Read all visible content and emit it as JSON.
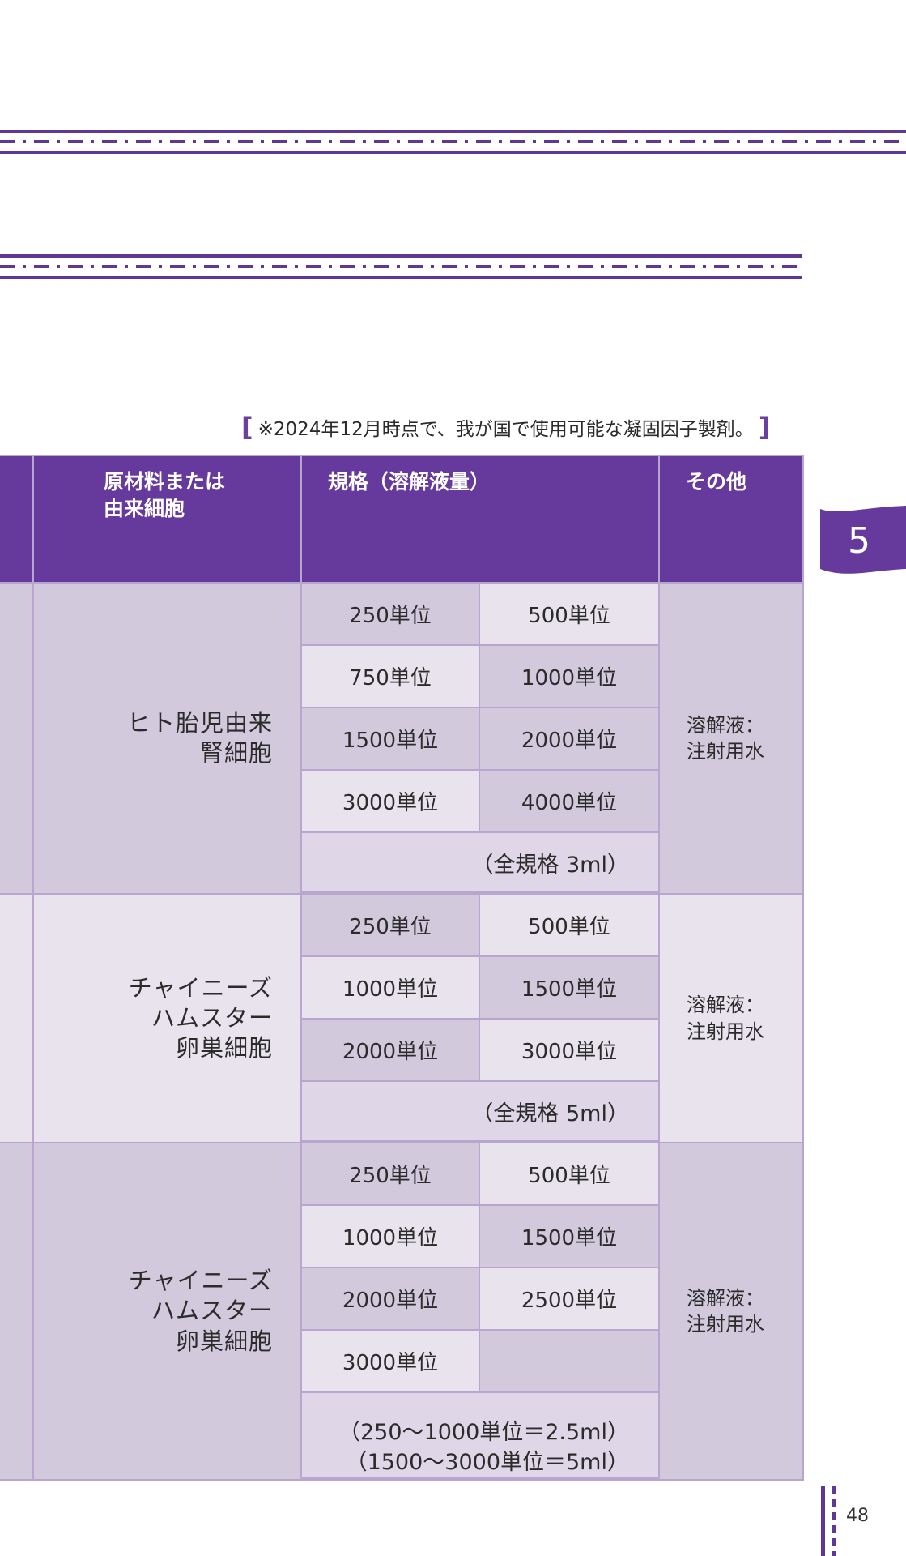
{
  "note": {
    "text": "※2024年12月時点で、我が国で使用可能な凝固因子製剤。",
    "bracket_left": "[",
    "bracket_right": "]"
  },
  "table": {
    "headers": {
      "source_line1": "原材料または",
      "source_line2": "由来細胞",
      "spec": "規格（溶解液量）",
      "other": "その他"
    },
    "rows": [
      {
        "source_lines": [
          "ヒト胎児由来",
          "腎細胞"
        ],
        "units": [
          [
            "250単位",
            "500単位"
          ],
          [
            "750単位",
            "1000単位"
          ],
          [
            "1500単位",
            "2000単位"
          ],
          [
            "3000単位",
            "4000単位"
          ]
        ],
        "note_lines": [
          "（全規格 3ml）"
        ],
        "other_lines": [
          "溶解液：",
          "注射用水"
        ]
      },
      {
        "source_lines": [
          "チャイニーズ",
          "ハムスター",
          "卵巣細胞"
        ],
        "units": [
          [
            "250単位",
            "500単位"
          ],
          [
            "1000単位",
            "1500単位"
          ],
          [
            "2000単位",
            "3000単位"
          ]
        ],
        "note_lines": [
          "（全規格 5ml）"
        ],
        "other_lines": [
          "溶解液：",
          "注射用水"
        ]
      },
      {
        "source_lines": [
          "チャイニーズ",
          "ハムスター",
          "卵巣細胞"
        ],
        "units": [
          [
            "250単位",
            "500単位"
          ],
          [
            "1000単位",
            "1500単位"
          ],
          [
            "2000単位",
            "2500単位"
          ],
          [
            "3000単位",
            ""
          ]
        ],
        "note_lines": [
          "（250～1000単位＝2.5ml）",
          "（1500～3000単位＝5ml）"
        ],
        "other_lines": [
          "溶解液：",
          "注射用水"
        ]
      }
    ]
  },
  "tab": {
    "label": "5"
  },
  "page": {
    "number": "48"
  },
  "colors": {
    "accent": "#653a9c",
    "pale": "#e8e3ec",
    "mid": "#d2c9dd",
    "lavender": "#dfd7e8"
  }
}
